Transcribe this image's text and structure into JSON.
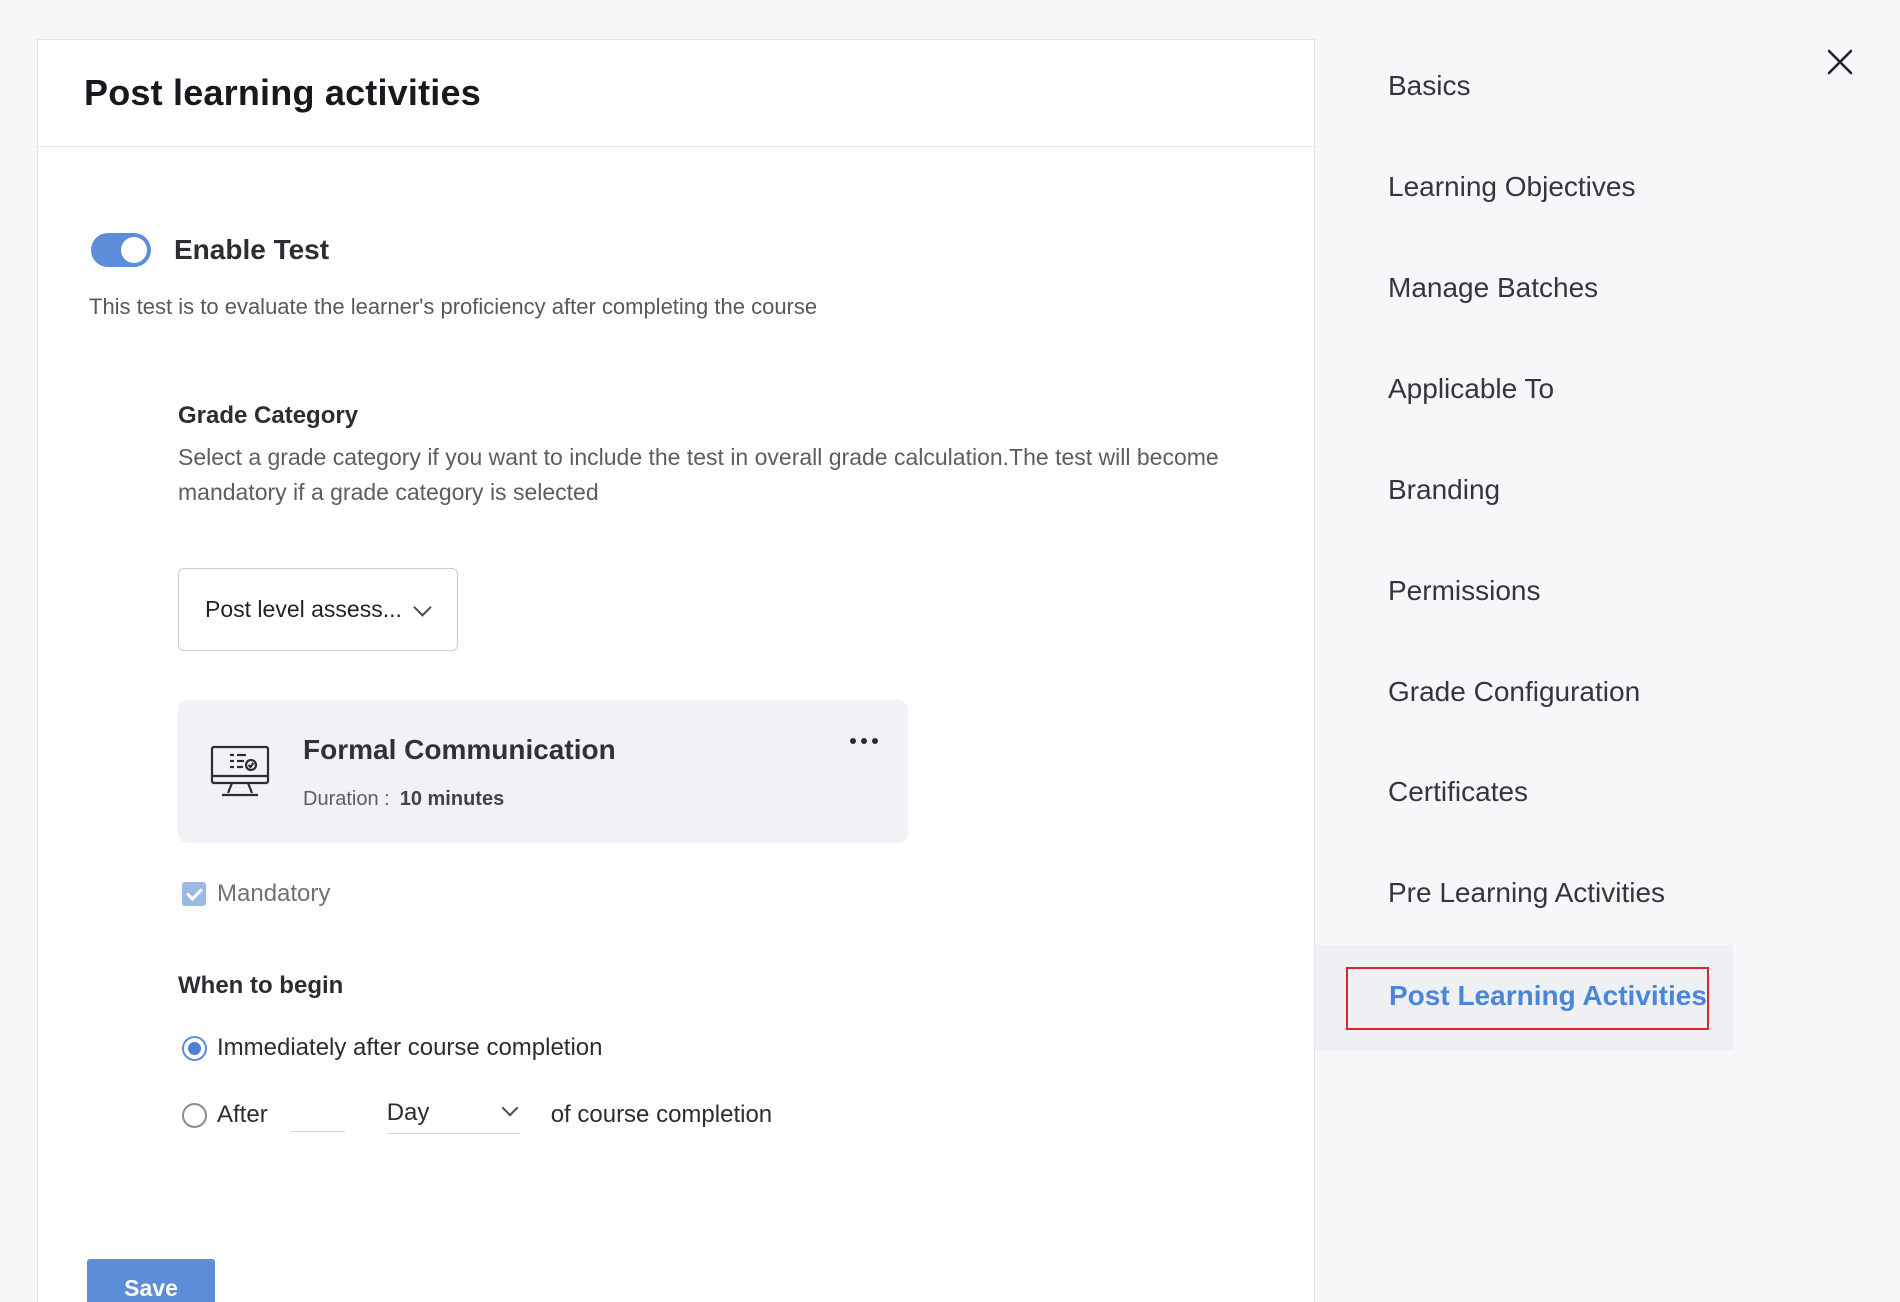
{
  "panel": {
    "title": "Post learning activities"
  },
  "enable_test": {
    "label": "Enable Test",
    "enabled": true,
    "description": "This test is to evaluate the learner's proficiency after completing the course"
  },
  "grade_category": {
    "title": "Grade Category",
    "description": "Select a grade category if you want to include the test in overall grade calculation.The test will become mandatory if a grade category is selected",
    "selected": "Post level assess..."
  },
  "test_card": {
    "icon": "monitor-test-icon",
    "title": "Formal Communication",
    "duration_label": "Duration :",
    "duration_value": "10 minutes"
  },
  "mandatory": {
    "label": "Mandatory",
    "checked": true
  },
  "when_to_begin": {
    "title": "When to begin",
    "option_immediate": "Immediately after course completion",
    "option_after": "After",
    "unit": "Day",
    "suffix": "of course completion",
    "selected": "immediate"
  },
  "save_label": "Save",
  "nav": {
    "items": [
      "Basics",
      "Learning Objectives",
      "Manage Batches",
      "Applicable To",
      "Branding",
      "Permissions",
      "Grade Configuration",
      "Certificates",
      "Pre Learning Activities",
      "Post Learning Activities"
    ],
    "active_index": 9
  },
  "colors": {
    "accent": "#5b8dd8",
    "active_nav": "#4a86d9",
    "highlight_outline": "#d9262c"
  }
}
